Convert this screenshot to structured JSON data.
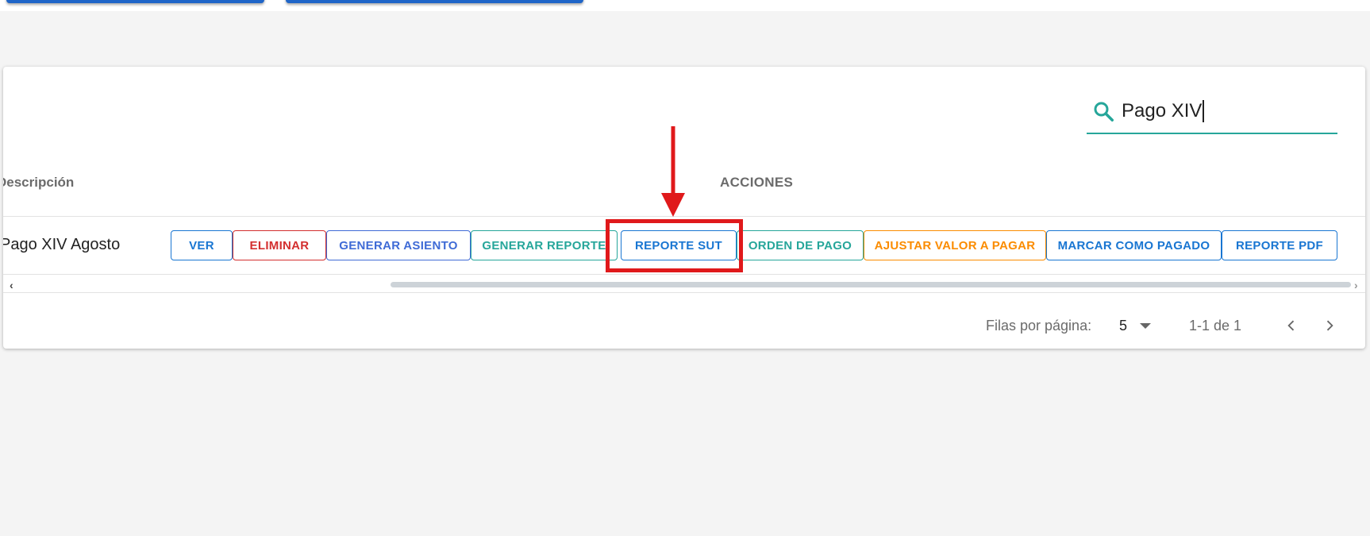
{
  "search": {
    "value": "Pago XIV"
  },
  "table": {
    "headers": {
      "description": "Descripción",
      "actions": "ACCIONES"
    },
    "rows": [
      {
        "description": "Pago XIV Agosto"
      }
    ]
  },
  "actions": [
    {
      "label": "VER",
      "color": "#1976d2"
    },
    {
      "label": "ELIMINAR",
      "color": "#d32f2f"
    },
    {
      "label": "GENERAR ASIENTO",
      "color": "#3f6bd6"
    },
    {
      "label": "GENERAR REPORTE",
      "color": "#26a69a"
    },
    {
      "label": "REPORTE SUT",
      "color": "#1976d2"
    },
    {
      "label": "ORDEN DE PAGO",
      "color": "#26a69a"
    },
    {
      "label": "AJUSTAR VALOR A PAGAR",
      "color": "#fb8c00"
    },
    {
      "label": "MARCAR COMO PAGADO",
      "color": "#1976d2"
    },
    {
      "label": "REPORTE PDF",
      "color": "#1976d2"
    }
  ],
  "pagination": {
    "rows_per_page_label": "Filas por página:",
    "rows_per_page_value": "5",
    "range_text": "1-1 de 1"
  },
  "icons": {
    "search": "search-icon",
    "dropdown": "chevron-down-icon",
    "prev": "chevron-left-icon",
    "next": "chevron-right-icon"
  },
  "colors": {
    "accent": "#26a69a",
    "annotation": "#e0191b"
  }
}
